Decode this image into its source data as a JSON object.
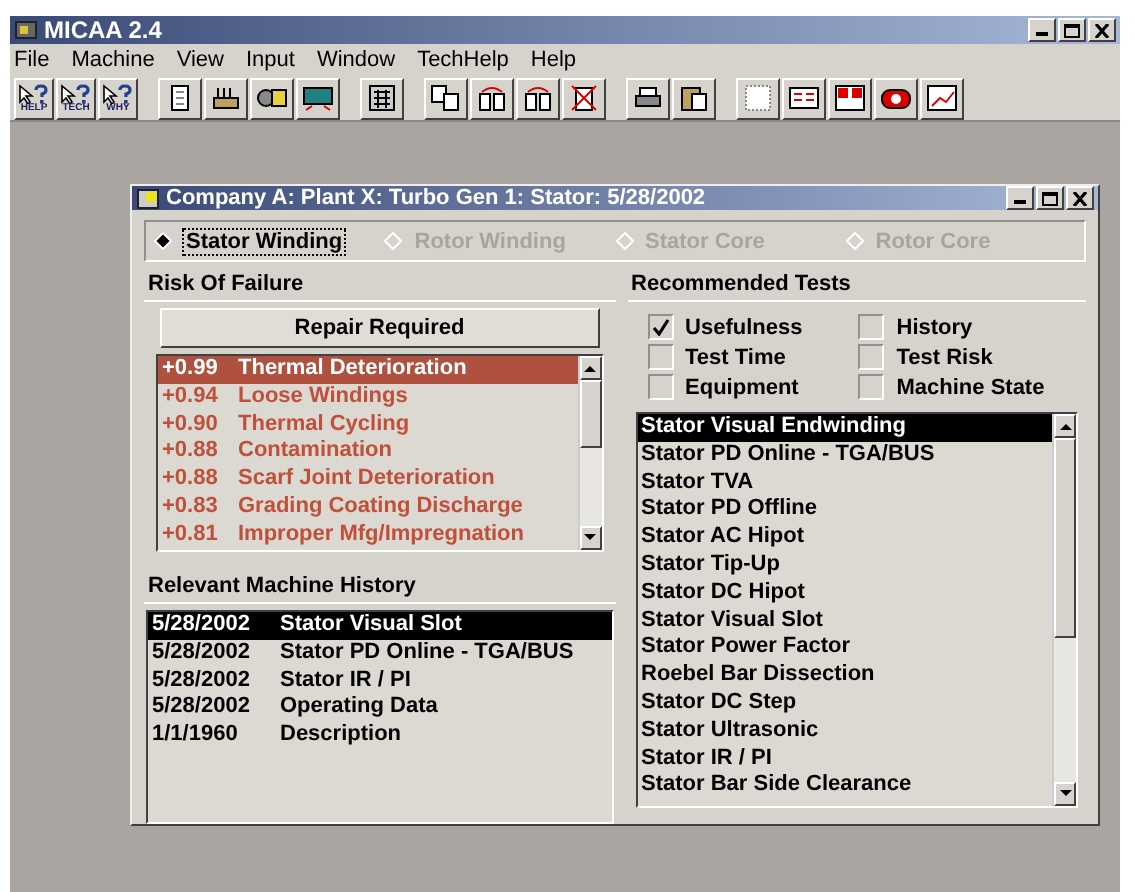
{
  "app": {
    "title": "MICAA 2.4"
  },
  "menu": [
    "File",
    "Machine",
    "View",
    "Input",
    "Window",
    "TechHelp",
    "Help"
  ],
  "toolbar": [
    [
      {
        "kind": "help",
        "label": "HELP"
      },
      {
        "kind": "help",
        "label": "TECH"
      },
      {
        "kind": "help",
        "label": "WHY"
      }
    ],
    [
      {
        "kind": "doc"
      },
      {
        "kind": "machine"
      },
      {
        "kind": "roll"
      },
      {
        "kind": "screen"
      }
    ],
    [
      {
        "kind": "calc"
      }
    ],
    [
      {
        "kind": "copy"
      },
      {
        "kind": "swap"
      },
      {
        "kind": "swap"
      },
      {
        "kind": "delete"
      }
    ],
    [
      {
        "kind": "print"
      },
      {
        "kind": "clipboard"
      }
    ],
    [
      {
        "kind": "grid"
      },
      {
        "kind": "form"
      },
      {
        "kind": "calendar"
      },
      {
        "kind": "aid"
      },
      {
        "kind": "chart"
      }
    ]
  ],
  "child": {
    "title": "Company A: Plant X: Turbo Gen 1: Stator: 5/28/2002",
    "tabs": [
      {
        "label": "Stator Winding",
        "selected": true
      },
      {
        "label": "Rotor Winding",
        "selected": false
      },
      {
        "label": "Stator Core",
        "selected": false
      },
      {
        "label": "Rotor Core",
        "selected": false
      }
    ],
    "risk": {
      "title": "Risk Of Failure",
      "button": "Repair Required",
      "items": [
        {
          "score": "+0.99",
          "name": "Thermal Deterioration",
          "selected": true
        },
        {
          "score": "+0.94",
          "name": "Loose Windings",
          "selected": false
        },
        {
          "score": "+0.90",
          "name": "Thermal Cycling",
          "selected": false
        },
        {
          "score": "+0.88",
          "name": "Contamination",
          "selected": false
        },
        {
          "score": "+0.88",
          "name": "Scarf Joint Deterioration",
          "selected": false
        },
        {
          "score": "+0.83",
          "name": "Grading Coating Discharge",
          "selected": false
        },
        {
          "score": "+0.81",
          "name": "Improper Mfg/Impregnation",
          "selected": false
        }
      ]
    },
    "history": {
      "title": "Relevant Machine History",
      "rows": [
        {
          "date": "5/28/2002",
          "description": "Stator Visual Slot",
          "selected": true
        },
        {
          "date": "5/28/2002",
          "description": "Stator PD Online - TGA/BUS",
          "selected": false
        },
        {
          "date": "5/28/2002",
          "description": "Stator IR / PI",
          "selected": false
        },
        {
          "date": "5/28/2002",
          "description": "Operating Data",
          "selected": false
        },
        {
          "date": "1/1/1960",
          "description": "Description",
          "selected": false
        }
      ]
    },
    "tests": {
      "title": "Recommended Tests",
      "options": [
        {
          "label": "Usefulness",
          "checked": true
        },
        {
          "label": "History",
          "checked": false
        },
        {
          "label": "Test Time",
          "checked": false
        },
        {
          "label": "Test Risk",
          "checked": false
        },
        {
          "label": "Equipment",
          "checked": false
        },
        {
          "label": "Machine State",
          "checked": false
        }
      ],
      "items": [
        {
          "label": "Stator Visual Endwinding",
          "selected": true
        },
        {
          "label": "Stator PD Online - TGA/BUS",
          "selected": false
        },
        {
          "label": "Stator TVA",
          "selected": false
        },
        {
          "label": "Stator PD Offline",
          "selected": false
        },
        {
          "label": "Stator AC Hipot",
          "selected": false
        },
        {
          "label": "Stator Tip-Up",
          "selected": false
        },
        {
          "label": "Stator DC Hipot",
          "selected": false
        },
        {
          "label": "Stator Visual Slot",
          "selected": false
        },
        {
          "label": "Stator Power Factor",
          "selected": false
        },
        {
          "label": "Roebel Bar Dissection",
          "selected": false
        },
        {
          "label": "Stator DC Step",
          "selected": false
        },
        {
          "label": "Stator Ultrasonic",
          "selected": false
        },
        {
          "label": "Stator IR / PI",
          "selected": false
        },
        {
          "label": "Stator Bar Side Clearance",
          "selected": false
        }
      ]
    }
  }
}
